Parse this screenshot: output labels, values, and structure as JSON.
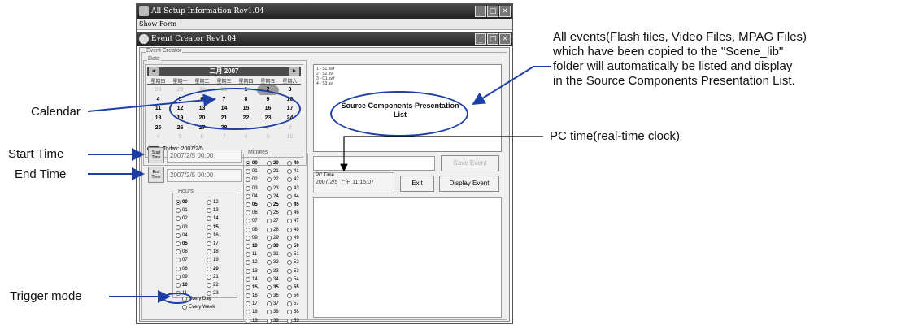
{
  "outer_window": {
    "title": "All Setup Information Rev1.04",
    "menu": "Show Form"
  },
  "inner_window": {
    "title": "Event Creator Rev1.04"
  },
  "groups": {
    "event_creator": "Event Creator",
    "date": "Date"
  },
  "calendar": {
    "month_label": "二月 2007",
    "prev": "◄",
    "next": "►",
    "weekdays": [
      "星期日",
      "星期一",
      "星期二",
      "星期三",
      "星期四",
      "星期五",
      "星期六"
    ],
    "days": [
      "28",
      "29",
      "30",
      "31",
      "1",
      "2",
      "3",
      "4",
      "5",
      "6",
      "7",
      "8",
      "9",
      "10",
      "11",
      "12",
      "13",
      "14",
      "15",
      "16",
      "17",
      "18",
      "19",
      "20",
      "21",
      "22",
      "23",
      "24",
      "25",
      "26",
      "27",
      "28",
      "1",
      "2",
      "3",
      "4",
      "5",
      "6",
      "7",
      "8",
      "9",
      "10"
    ],
    "today_label": "Today: 2007/2/5"
  },
  "start_time": {
    "button": "Start Time",
    "value": "2007/2/5 00:00"
  },
  "end_time": {
    "button": "End Time",
    "value": "2007/2/5 00:00"
  },
  "hours": {
    "label": "Hours",
    "left": [
      "00",
      "01",
      "02",
      "03",
      "04",
      "05",
      "06",
      "07",
      "08",
      "09",
      "10",
      "11"
    ],
    "right": [
      "12",
      "13",
      "14",
      "15",
      "16",
      "17",
      "18",
      "19",
      "20",
      "21",
      "22",
      "23"
    ],
    "selected": "00"
  },
  "minutes": {
    "label": "Minutes",
    "c1": [
      "00",
      "01",
      "02",
      "03",
      "04",
      "05",
      "06",
      "07",
      "08",
      "09",
      "10",
      "11",
      "12",
      "13",
      "14",
      "15",
      "16",
      "17",
      "18",
      "19"
    ],
    "c2": [
      "20",
      "21",
      "22",
      "23",
      "24",
      "25",
      "26",
      "27",
      "28",
      "29",
      "30",
      "31",
      "32",
      "33",
      "34",
      "35",
      "36",
      "37",
      "38",
      "39"
    ],
    "c3": [
      "40",
      "41",
      "42",
      "43",
      "44",
      "45",
      "46",
      "47",
      "48",
      "49",
      "50",
      "51",
      "52",
      "53",
      "54",
      "55",
      "56",
      "57",
      "58",
      "59"
    ],
    "selected": "00"
  },
  "trigger": {
    "every_day": "Every Day",
    "every_week": "Every Week"
  },
  "source_list": [
    "1 - S1.swf",
    "2 - S2.avi",
    "3 - C1.swf",
    "4 - S3.avi"
  ],
  "buttons": {
    "save_event": "Save Event",
    "exit": "Exit",
    "display_event": "Display Event"
  },
  "pc_time": {
    "label": "PC Time",
    "value": "2007/2/5 上午 11:15:07"
  },
  "annotations": {
    "calendar": "Calendar",
    "start_time": "Start Time",
    "end_time": "End Time",
    "trigger_mode": "Trigger mode",
    "source_components": "Source Components Presentation List",
    "pc_time": "PC time(real-time clock)",
    "events_line1": "All events(Flash files, Video Files, MPAG Files)",
    "events_line2": "which have been copied to the \"Scene_lib\"",
    "events_line3": "folder will automatically be listed and display",
    "events_line4": "in the Source Components Presentation List."
  },
  "colors": {
    "annotation_arrow": "#1b3fa6",
    "titlebar": "#333333"
  }
}
